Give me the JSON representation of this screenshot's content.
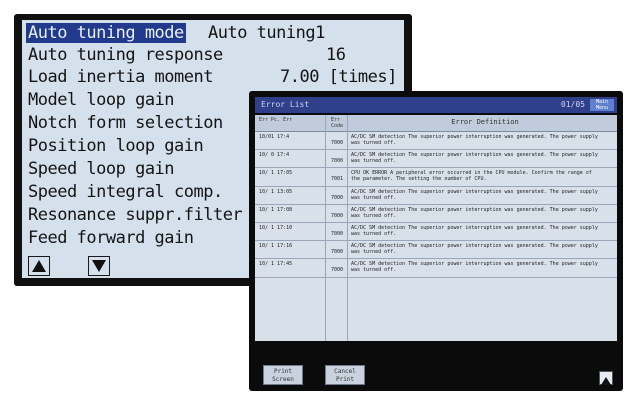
{
  "tuning": {
    "rows": [
      {
        "label": "Auto tuning mode",
        "value": "Auto tuning1",
        "highlight": true
      },
      {
        "label": "Auto tuning response",
        "value": "16"
      },
      {
        "label": "Load inertia moment",
        "value": "7.00 [times]"
      },
      {
        "label": "Model loop gain",
        "value": ""
      },
      {
        "label": "Notch form selection",
        "value": ""
      },
      {
        "label": "Position loop gain",
        "value": ""
      },
      {
        "label": "Speed loop gain",
        "value": ""
      },
      {
        "label": "Speed integral comp.",
        "value": ""
      },
      {
        "label": "Resonance suppr.filter",
        "value": ""
      },
      {
        "label": "Feed forward gain",
        "value": ""
      }
    ],
    "buttons": {
      "up": "up-arrow-icon",
      "down": "down-arrow-icon"
    }
  },
  "error_list": {
    "title": "Error List",
    "page": "01/05",
    "menu_label": "Main Menu",
    "columns": {
      "time": "Err Pc. Err",
      "code": "Err Code",
      "definition": "Error Definition"
    },
    "rows": [
      {
        "datetime": "10/01 17:4",
        "code": "7000",
        "text": "AC/DC SM detection  The superior power interruption was generated. The power supply was turned off."
      },
      {
        "datetime": "10/ 0 17:4",
        "code": "7000",
        "text": "AC/DC SM detection  The superior power interruption was generated. The power supply was turned off."
      },
      {
        "datetime": "10/ 1 17:05",
        "code": "7001",
        "text": "CPU OK ERROR  A peripheral error occurred in the CPU module. Confirm the range of the parameter. The setting the number of CPU."
      },
      {
        "datetime": "10/ 1 13:05",
        "code": "7000",
        "text": "AC/DC SM detection  The superior power interruption was generated. The power supply was turned off."
      },
      {
        "datetime": "10/ 1 17:08",
        "code": "7000",
        "text": "AC/DC SM detection  The superior power interruption was generated. The power supply was turned off."
      },
      {
        "datetime": "10/ 1 17:10",
        "code": "7000",
        "text": "AC/DC SM detection  The superior power interruption was generated. The power supply was turned off."
      },
      {
        "datetime": "10/ 1 17:16",
        "code": "7000",
        "text": "AC/DC SM detection  The superior power interruption was generated. The power supply was turned off."
      },
      {
        "datetime": "10/ 1 17:45",
        "code": "7000",
        "text": "AC/DC SM detection  The superior power interruption was generated. The power supply was turned off."
      }
    ],
    "footer": {
      "print_screen": "Print Screen",
      "cancel_print": "Cancel Print"
    }
  }
}
